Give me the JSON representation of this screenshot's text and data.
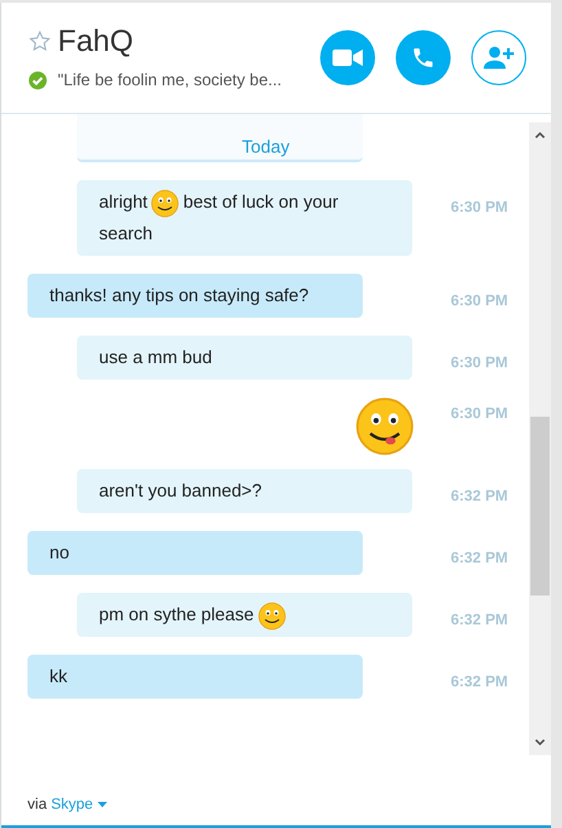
{
  "contact": {
    "name": "FahQ",
    "favorite": false,
    "online": true,
    "mood": "\"Life be foolin me, society be..."
  },
  "actions": [
    {
      "kind": "video",
      "outlined": false
    },
    {
      "kind": "call",
      "outlined": false
    },
    {
      "kind": "add-contact",
      "outlined": true
    }
  ],
  "day_divider": "Today",
  "messages": [
    {
      "kind": "sent",
      "parts": [
        {
          "kind": "text",
          "text": "alright"
        },
        {
          "kind": "smiley"
        },
        {
          "kind": "text",
          "text": "best of luck on your search"
        }
      ],
      "time": "6:30 PM"
    },
    {
      "kind": "received",
      "parts": [
        {
          "kind": "text",
          "text": "thanks! any tips on staying safe?"
        }
      ],
      "time": "6:30 PM"
    },
    {
      "kind": "sent",
      "parts": [
        {
          "kind": "text",
          "text": "use a mm bud"
        }
      ],
      "time": "6:30 PM"
    },
    {
      "kind": "emoticon",
      "time": "6:30 PM"
    },
    {
      "kind": "sent",
      "parts": [
        {
          "kind": "text",
          "text": "aren't you banned>?"
        }
      ],
      "time": "6:32 PM"
    },
    {
      "kind": "received",
      "parts": [
        {
          "kind": "text",
          "text": "no"
        }
      ],
      "time": "6:32 PM"
    },
    {
      "kind": "sent",
      "parts": [
        {
          "kind": "text",
          "text": "pm on sythe please"
        },
        {
          "kind": "smiley"
        }
      ],
      "time": "6:32 PM"
    },
    {
      "kind": "received",
      "parts": [
        {
          "kind": "text",
          "text": "kk"
        }
      ],
      "time": "6:32 PM"
    }
  ],
  "footer": {
    "via": "via",
    "service": "Skype"
  }
}
